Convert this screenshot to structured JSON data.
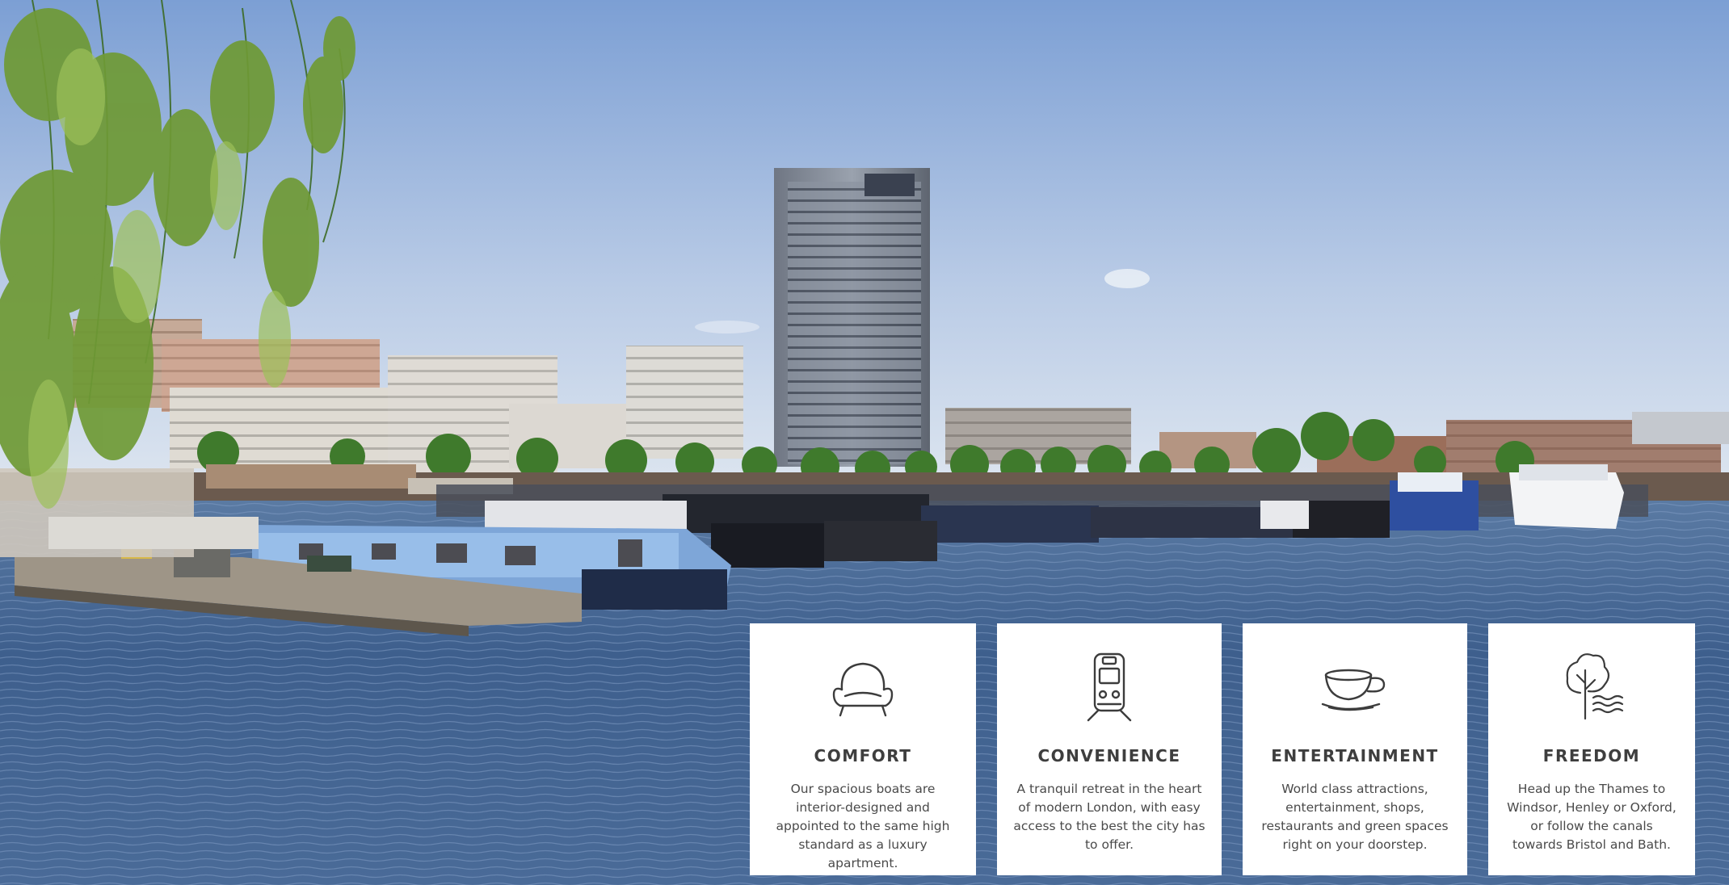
{
  "features": [
    {
      "icon": "armchair-icon",
      "title": "COMFORT",
      "text": "Our spacious boats are interior-designed and appointed to the same high standard as a luxury apartment."
    },
    {
      "icon": "train-icon",
      "title": "CONVENIENCE",
      "text": "A tranquil retreat in the heart of modern London, with easy access to the best the city has to offer."
    },
    {
      "icon": "coffee-cup-icon",
      "title": "ENTERTAINMENT",
      "text": "World class attractions, entertainment, shops, restaurants and green spaces right on your doorstep."
    },
    {
      "icon": "tree-water-icon",
      "title": "FREEDOM",
      "text": "Head up the Thames to Windsor, Henley or Oxford, or follow the canals towards Bristol and Bath."
    }
  ],
  "colors": {
    "sky_top": "#7fa3d6",
    "sky_bottom": "#dfe8f2",
    "water": "#3d5d8c",
    "card_background": "#ffffff",
    "text": "#3e3e3e"
  }
}
